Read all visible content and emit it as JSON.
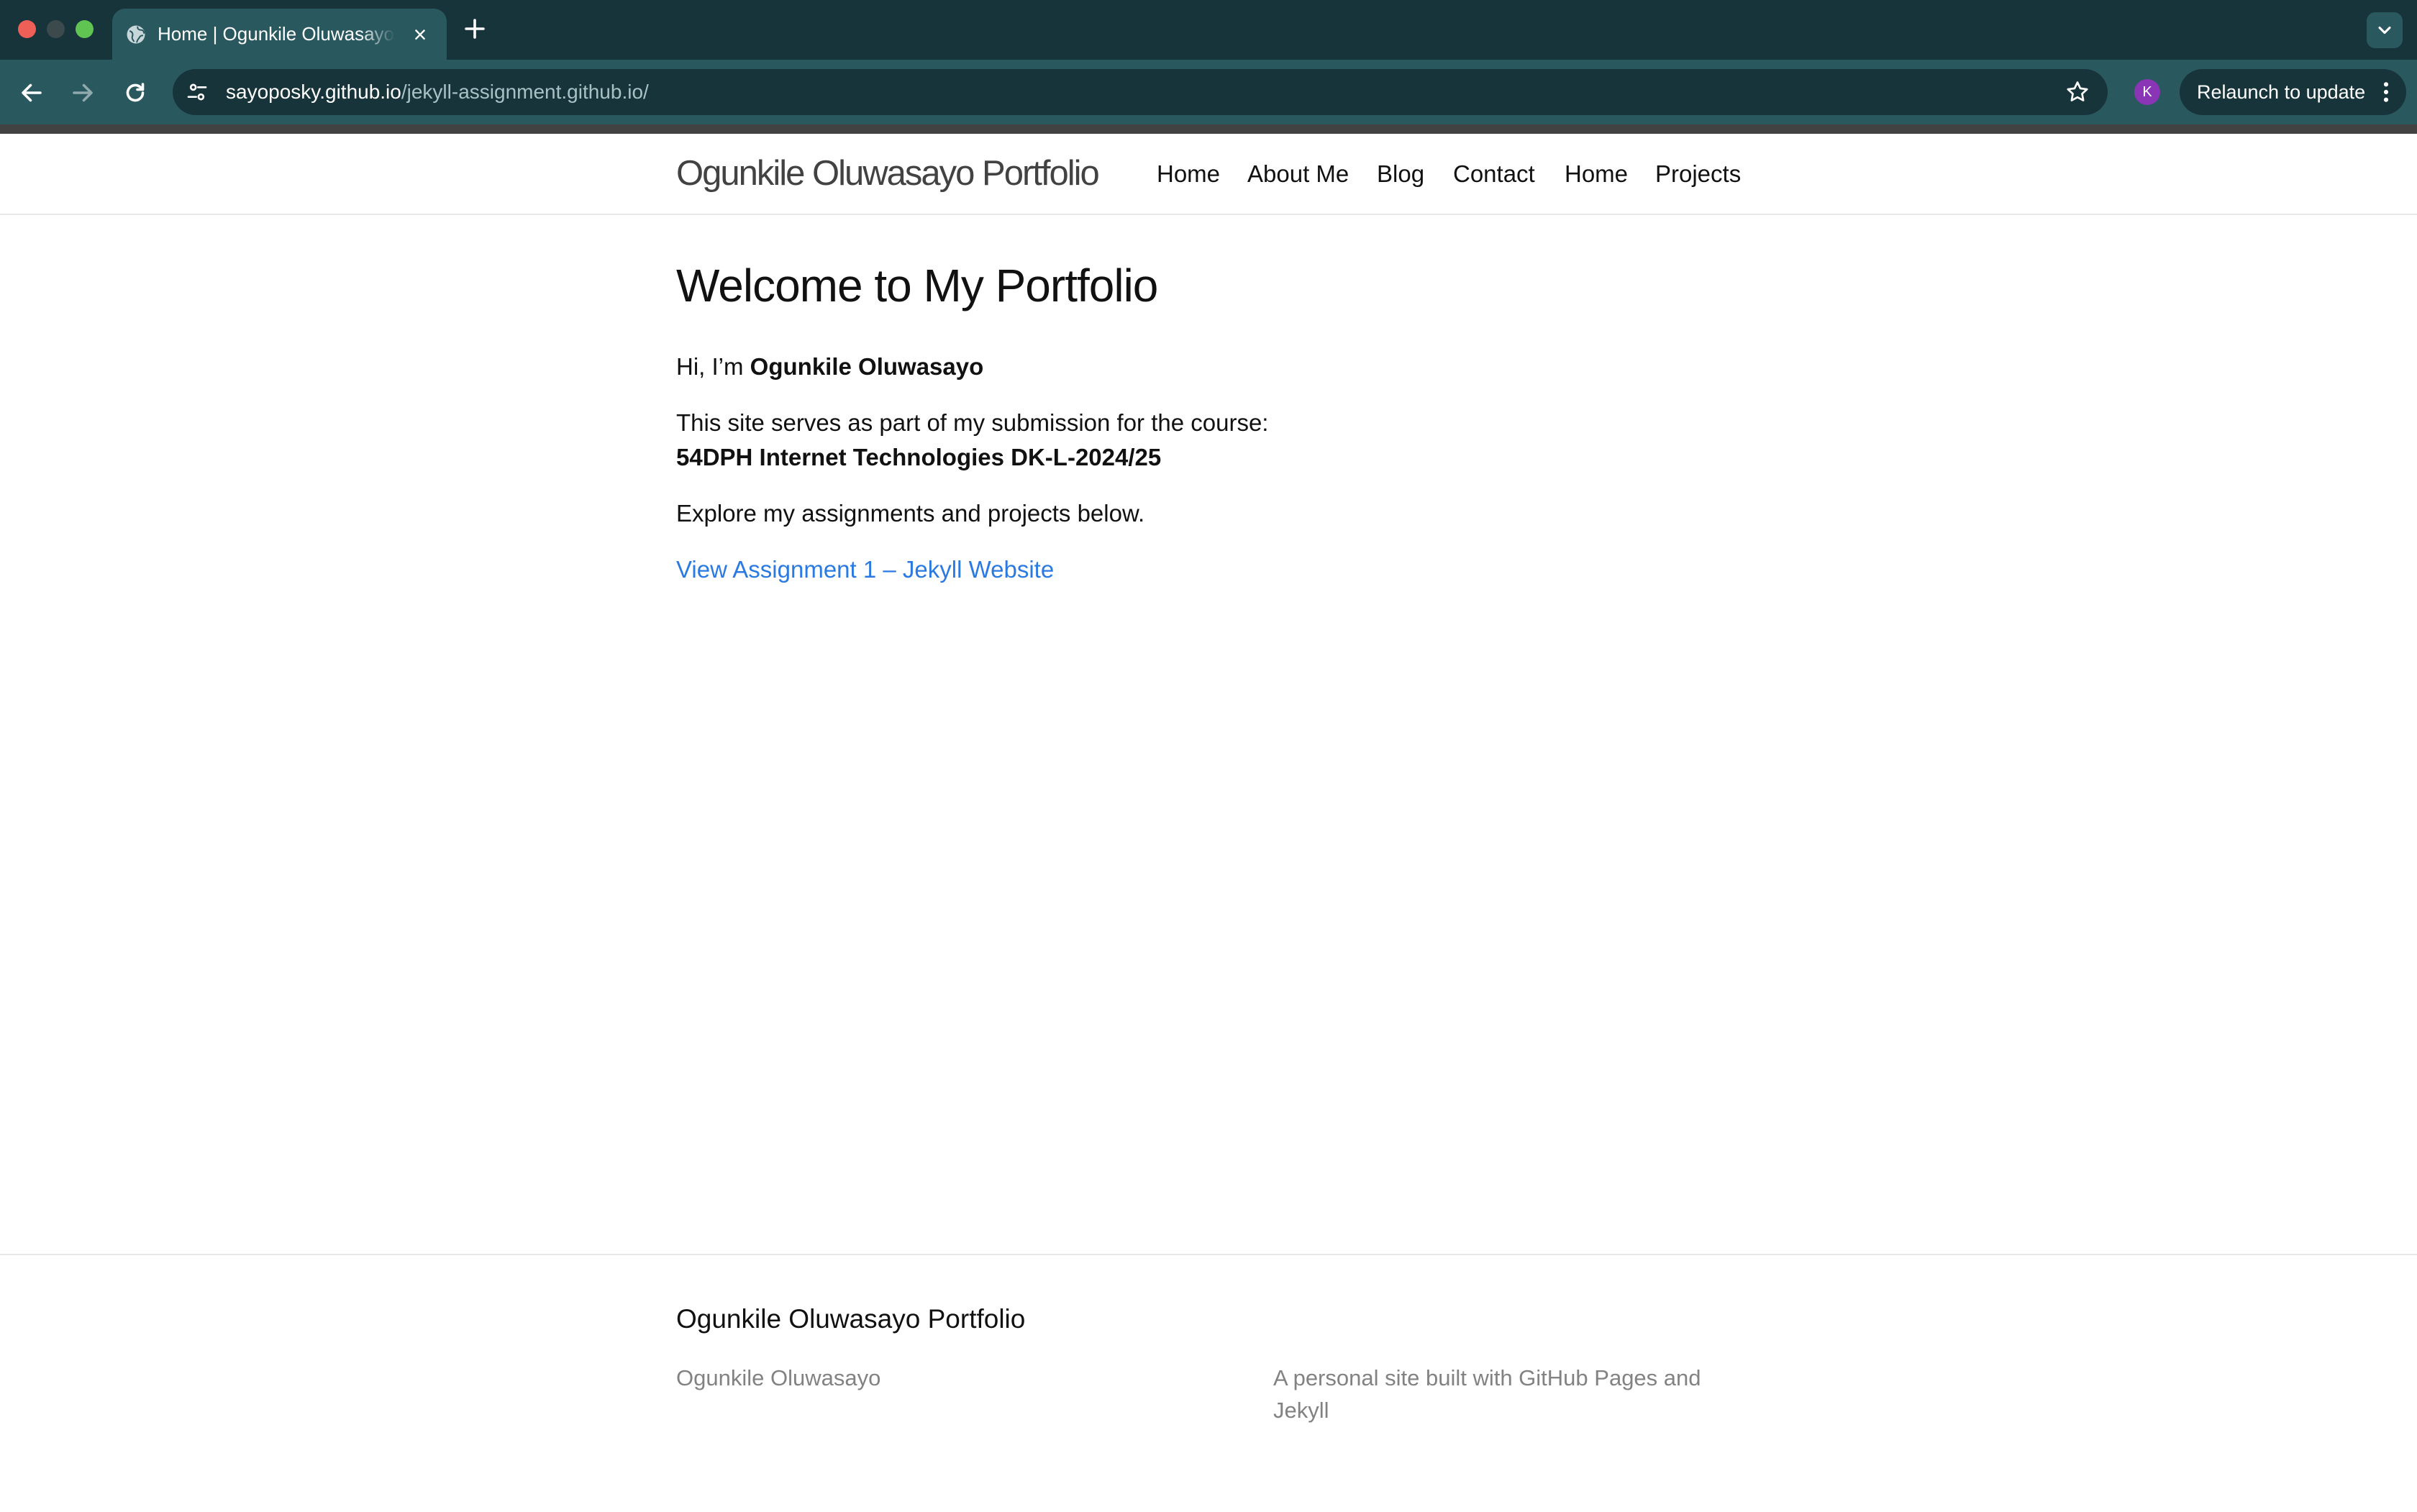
{
  "browser": {
    "tab": {
      "title": "Home | Ogunkile Oluwasayo Portfolio",
      "close_glyph": "×",
      "icon": "globe-icon"
    },
    "new_tab_icon": "plus-icon",
    "tab_search_icon": "chevron-down-icon",
    "back_icon": "arrow-left-icon",
    "forward_icon": "arrow-right-icon",
    "reload_icon": "reload-icon",
    "site_info_icon": "tune-icon",
    "bookmark_icon": "star-icon",
    "url_host": "sayoposky.github.io",
    "url_path": "/jekyll-assignment.github.io/",
    "profile_initial": "K",
    "relaunch_label": "Relaunch to update",
    "menu_icon": "kebab-menu-icon",
    "colors": {
      "frame": "#17343b",
      "toolbar": "#2a585f",
      "avatar": "#8a34b6"
    }
  },
  "site": {
    "title": "Ogunkile Oluwasayo Portfolio",
    "nav": [
      {
        "label": "Home"
      },
      {
        "label": "About Me"
      },
      {
        "label": "Blog"
      },
      {
        "label": "Contact"
      },
      {
        "label": "Home"
      },
      {
        "label": "Projects"
      }
    ]
  },
  "content": {
    "heading": "Welcome to My Portfolio",
    "greeting_prefix": "Hi, I’m ",
    "greeting_name": "Ogunkile Oluwasayo",
    "course_intro": "This site serves as part of my submission for the course:",
    "course_name": "54DPH Internet Technologies DK-L-2024/25",
    "explore_text": "Explore my assignments and projects below.",
    "assignment_link": "View Assignment 1 – Jekyll Website",
    "link_color": "#2a7ae2"
  },
  "footer": {
    "heading": "Ogunkile Oluwasayo Portfolio",
    "author": "Ogunkile Oluwasayo",
    "description": "A personal site built with GitHub Pages and Jekyll"
  }
}
